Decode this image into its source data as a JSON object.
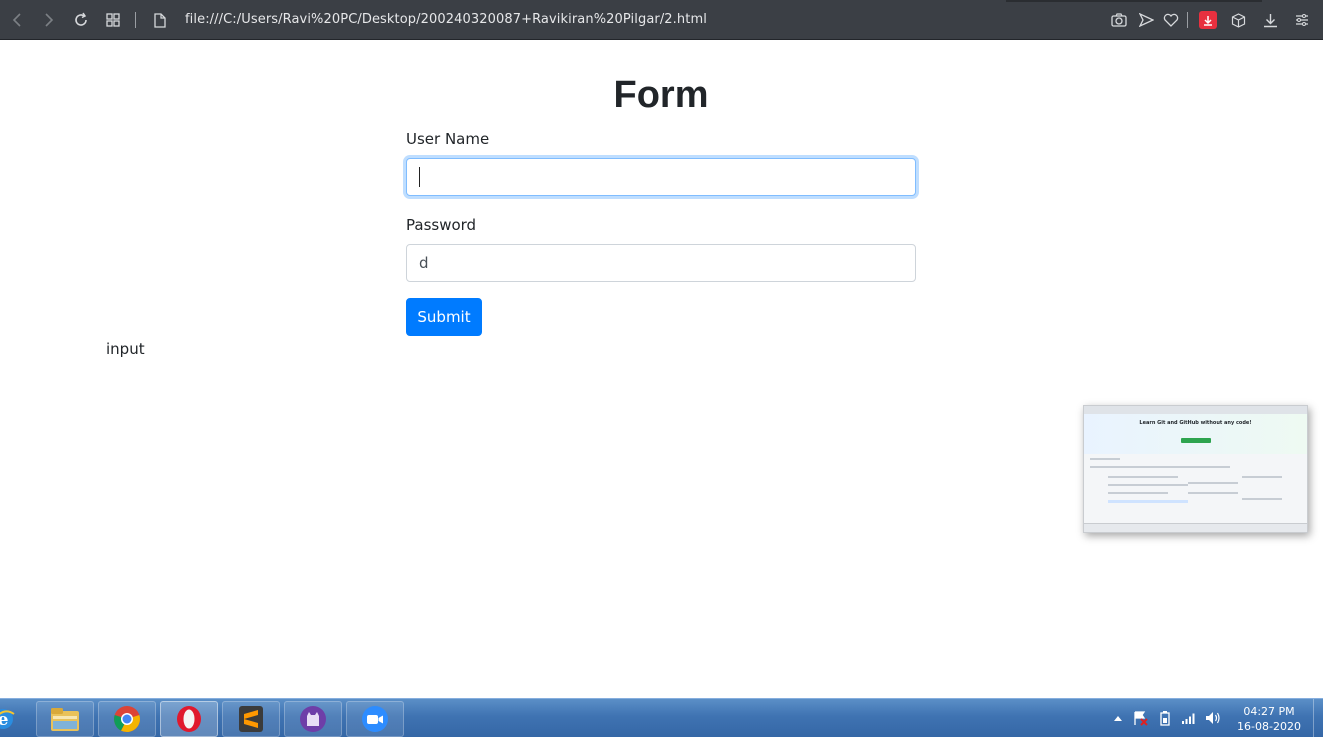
{
  "browser": {
    "url": "file:///C:/Users/Ravi%20PC/Desktop/200240320087+Ravikiran%20Pilgar/2.html",
    "badge_color": "#e8303f"
  },
  "form": {
    "title": "Form",
    "username_label": "User Name",
    "username_value": "",
    "password_label": "Password",
    "password_value": "d",
    "submit_label": "Submit",
    "accent_color": "#007bff"
  },
  "stray_text": "input",
  "preview": {
    "heading": "Learn Git and GitHub without any code!"
  },
  "taskbar": {
    "apps": [
      "internet-explorer",
      "file-explorer",
      "chrome",
      "opera",
      "sublime-text",
      "github-desktop",
      "zoom"
    ],
    "time": "04:27 PM",
    "date": "16-08-2020"
  }
}
